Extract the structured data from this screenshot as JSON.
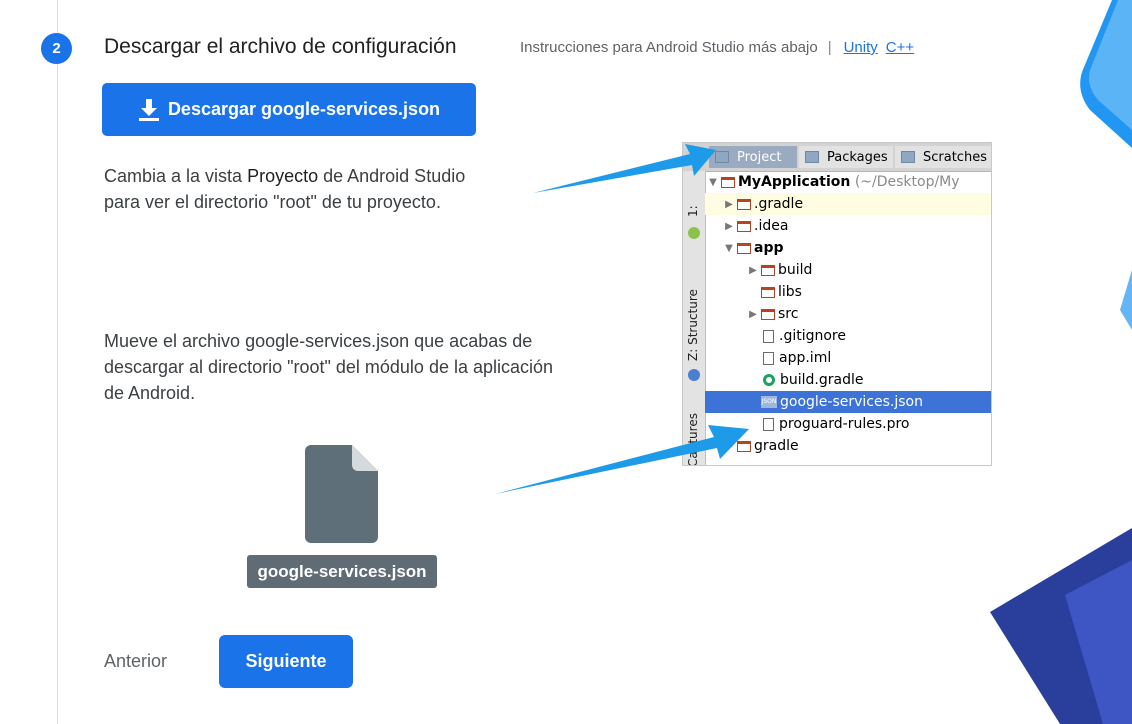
{
  "step": {
    "number": "2",
    "title": "Descargar el archivo de configuración",
    "subtitle": "Instrucciones para Android Studio más abajo",
    "separator": "|",
    "links": [
      "Unity",
      "C++"
    ]
  },
  "download_button": {
    "label": "Descargar google-services.json",
    "icon": "download-icon"
  },
  "paragraph1": {
    "before": "Cambia a la vista ",
    "bold": "Proyecto",
    "after": " de Android Studio para ver el directorio \"root\" de tu proyecto."
  },
  "paragraph2": "Mueve el archivo google-services.json que acabas de descargar al directorio \"root\" del módulo de la aplicación de Android.",
  "file": {
    "label": "google-services.json",
    "icon": "file-icon"
  },
  "nav": {
    "prev": "Anterior",
    "next": "Siguiente"
  },
  "ide": {
    "tabs": [
      "Project",
      "Packages",
      "Scratches"
    ],
    "side_labels": [
      "1:",
      "Z: Structure",
      "Captures"
    ],
    "tree": {
      "root_name": "MyApplication",
      "root_path": "(~/Desktop/My",
      "gradle_hidden": ".gradle",
      "idea": ".idea",
      "app": "app",
      "build": "build",
      "libs": "libs",
      "src": "src",
      "gitignore": ".gitignore",
      "app_iml": "app.iml",
      "build_gradle": "build.gradle",
      "google_services": "google-services.json",
      "proguard": "proguard-rules.pro",
      "gradle": "gradle"
    }
  },
  "colors": {
    "accent": "#1a73e8",
    "file_label_bg": "#5f6b75",
    "arrow": "#1e9be8"
  }
}
